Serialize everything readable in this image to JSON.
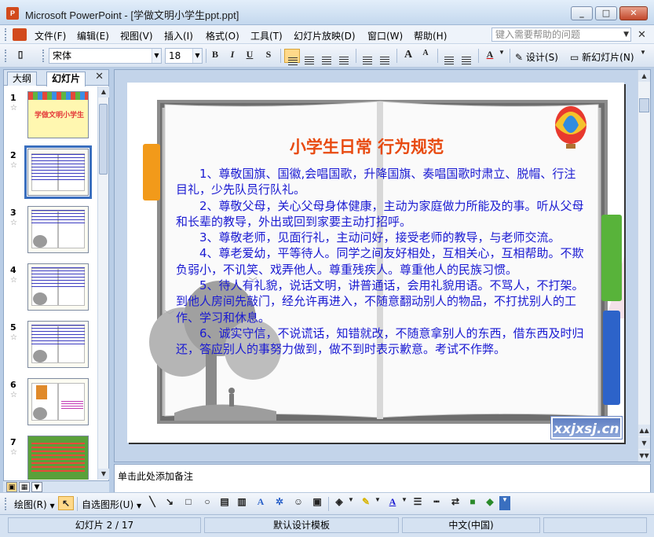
{
  "window": {
    "app": "Microsoft PowerPoint",
    "title": "Microsoft PowerPoint - [学做文明小学生ppt.ppt]",
    "icon_label": "P",
    "min": "_",
    "max": "□",
    "close": "✕"
  },
  "menu": {
    "items": [
      "文件(F)",
      "编辑(E)",
      "视图(V)",
      "插入(I)",
      "格式(O)",
      "工具(T)",
      "幻灯片放映(D)",
      "窗口(W)",
      "帮助(H)"
    ],
    "help_placeholder": "键入需要帮助的问题",
    "close": "✕"
  },
  "toolbar": {
    "font": "宋体",
    "size": "18",
    "bold": "B",
    "italic": "I",
    "underline": "U",
    "shadow": "S",
    "design": "设计(S)",
    "new_slide": "新幻灯片(N)",
    "grow": "A",
    "shrink": "A",
    "color": "A"
  },
  "panes": {
    "tab_outline": "大纲",
    "tab_slides": "幻灯片",
    "tab_close": "✕",
    "thumbnails": [
      {
        "num": "1",
        "caption": "学做文明小学生"
      },
      {
        "num": "2"
      },
      {
        "num": "3"
      },
      {
        "num": "4"
      },
      {
        "num": "5"
      },
      {
        "num": "6"
      },
      {
        "num": "7"
      }
    ]
  },
  "slide": {
    "title": "小学生日常 行为规范",
    "paragraphs": [
      "1、尊敬国旗、国徽,会唱国歌，升降国旗、奏唱国歌时肃立、脱帽、行注目礼，少先队员行队礼。",
      "2、尊敬父母，关心父母身体健康，主动为家庭做力所能及的事。听从父母和长辈的教导，外出或回到家要主动打招呼。",
      "3、尊敬老师，见面行礼，主动问好，接受老师的教导，与老师交流。",
      "4、尊老爱幼，平等待人。同学之间友好相处，互相关心，互相帮助。不欺负弱小，不讥笑、戏弄他人。尊重残疾人。尊重他人的民族习惯。",
      "5、待人有礼貌，说话文明，讲普通话，会用礼貌用语。不骂人，不打架。到他人房间先敲门，经允许再进入，不随意翻动别人的物品，不打扰别人的工作、学习和休息。",
      "6、诚实守信，不说谎话，知错就改，不随意拿别人的东西，借东西及时归还，答应别人的事努力做到，做不到时表示歉意。考试不作弊。"
    ],
    "watermark": "xxjxsj.cn"
  },
  "notes": {
    "placeholder": "单击此处添加备注"
  },
  "drawing": {
    "draw": "绘图(R)",
    "autoshape": "自选图形(U)"
  },
  "status": {
    "slide": "幻灯片 2 / 17",
    "template": "默认设计模板",
    "language": "中文(中国)"
  },
  "colors": {
    "title_red": "#e84a10",
    "body_blue": "#1a1ad2",
    "selection": "#3a6fbf"
  }
}
